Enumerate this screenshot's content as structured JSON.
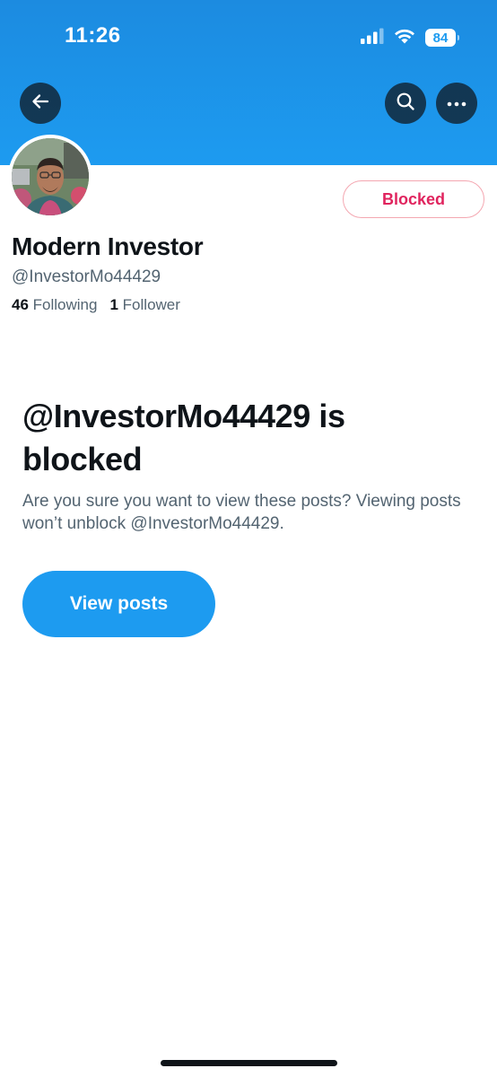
{
  "status_bar": {
    "time": "11:26",
    "battery": "84"
  },
  "header": {
    "back_icon": "arrow-left-icon",
    "search_icon": "search-icon",
    "more_icon": "more-horizontal-icon"
  },
  "profile": {
    "display_name": "Modern Investor",
    "handle": "@InvestorMo44429",
    "following_count": "46",
    "following_label": "Following",
    "followers_count": "1",
    "followers_label": "Follower",
    "blocked_label": "Blocked"
  },
  "blocked_notice": {
    "title": "@InvestorMo44429 is blocked",
    "description": "Are you sure you want to view these posts? Viewing posts won’t unblock @InvestorMo44429.",
    "button_label": "View posts"
  },
  "colors": {
    "banner": "#1d9bf0",
    "accent": "#1d9bf0",
    "blocked_red": "#e0245e",
    "text_primary": "#0f1419",
    "text_secondary": "#536471"
  }
}
